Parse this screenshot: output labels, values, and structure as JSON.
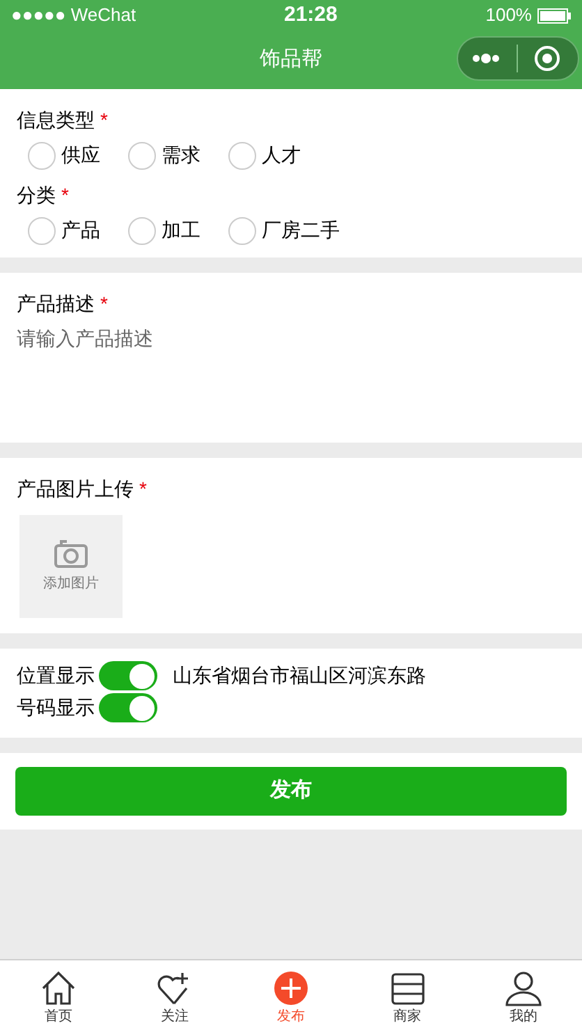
{
  "status_bar": {
    "carrier": "●●●●● WeChat",
    "time": "21:28",
    "battery": "100%"
  },
  "nav": {
    "title": "饰品帮"
  },
  "info_type": {
    "label": "信息类型",
    "required": "*",
    "options": [
      {
        "label": "供应",
        "selected": false
      },
      {
        "label": "需求",
        "selected": false
      },
      {
        "label": "人才",
        "selected": false
      }
    ]
  },
  "category": {
    "label": "分类",
    "required": "*",
    "options": [
      {
        "label": "产品",
        "selected": false
      },
      {
        "label": "加工",
        "selected": false
      },
      {
        "label": "厂房二手",
        "selected": false
      }
    ]
  },
  "description": {
    "label": "产品描述",
    "required": "*",
    "placeholder": "请输入产品描述"
  },
  "upload": {
    "label": "产品图片上传",
    "required": "*",
    "button": "添加图片"
  },
  "toggles": [
    {
      "label": "位置显示",
      "on": true,
      "value": "山东省烟台市福山区河滨东路"
    },
    {
      "label": "号码显示",
      "on": true
    }
  ],
  "submit": "发布",
  "tabbar": [
    {
      "label": "首页",
      "kind": "home",
      "selected": false
    },
    {
      "label": "关注",
      "kind": "heart",
      "selected": false
    },
    {
      "label": "发布",
      "kind": "plus",
      "selected": true
    },
    {
      "label": "商家",
      "kind": "shop",
      "selected": false
    },
    {
      "label": "我的",
      "kind": "user",
      "selected": false
    }
  ]
}
